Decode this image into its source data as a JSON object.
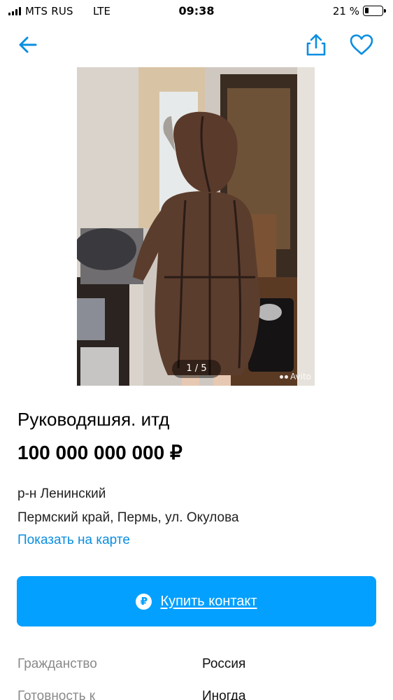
{
  "status_bar": {
    "carrier": "MTS RUS",
    "network": "LTE",
    "time": "09:38",
    "battery_percent": "21 %",
    "battery_level": 0.21
  },
  "nav": {
    "back_icon": "arrow-left-icon",
    "share_icon": "share-icon",
    "favorite_icon": "heart-icon",
    "accent_color": "#0a8ee0"
  },
  "gallery": {
    "counter": "1 / 5",
    "watermark": "Avito"
  },
  "listing": {
    "title": "Руководяшяя. итд",
    "price": "100 000 000 000 ₽",
    "district": "р-н Ленинский",
    "address": "Пермский край, Пермь, ул. Окулова",
    "map_link": "Показать на карте"
  },
  "buy_button": {
    "icon": "₽",
    "label": "Купить контакт",
    "color": "#04a0ff"
  },
  "params": [
    {
      "key": "Гражданство",
      "value": "Россия"
    },
    {
      "key": "Готовность к",
      "value": "Иногда"
    }
  ]
}
